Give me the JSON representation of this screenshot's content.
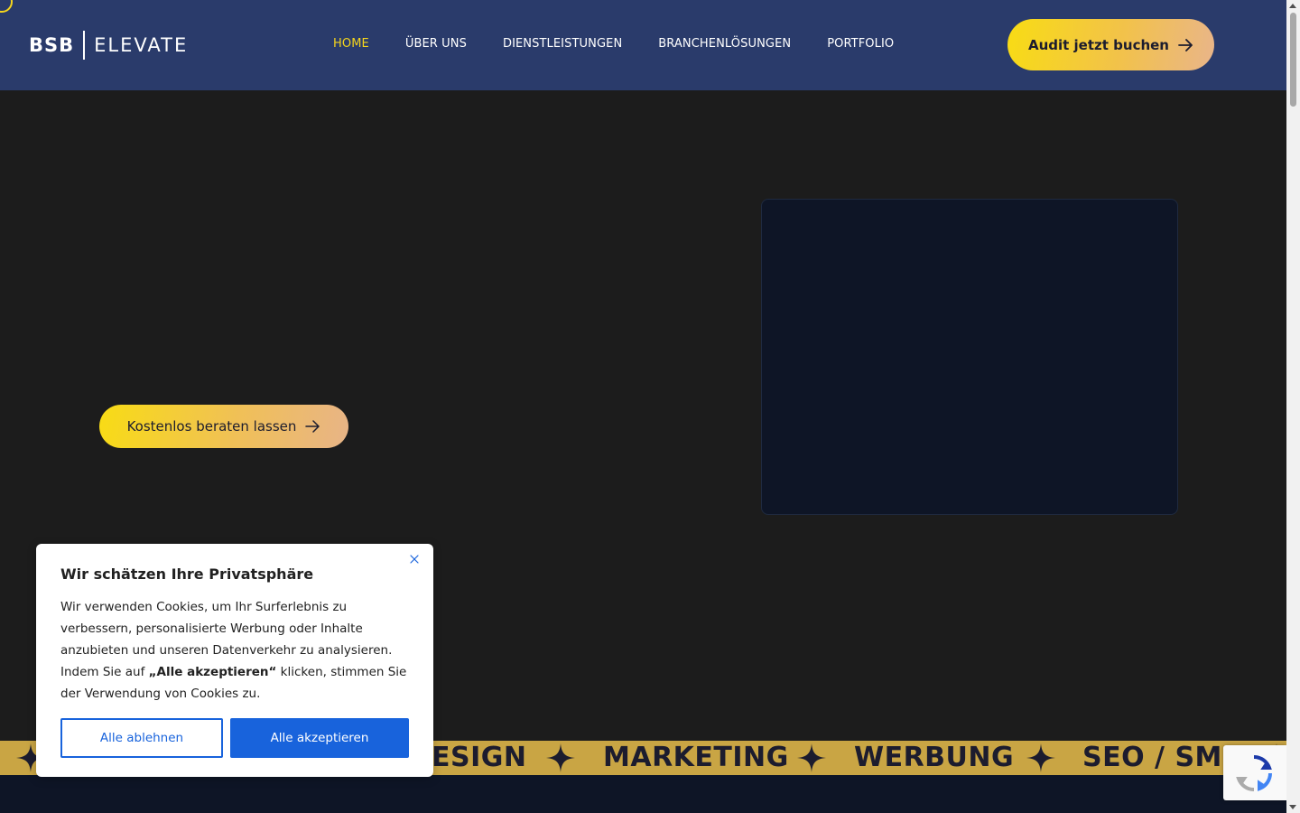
{
  "brand": {
    "part1": "BSB",
    "part2": "ELEVATE"
  },
  "nav": {
    "items": [
      {
        "label": "HOME",
        "active": true
      },
      {
        "label": "ÜBER UNS"
      },
      {
        "label": "DIENSTLEISTUNGEN"
      },
      {
        "label": "BRANCHENLÖSUNGEN"
      },
      {
        "label": "PORTFOLIO"
      }
    ]
  },
  "header": {
    "cta_label": "Audit jetzt buchen"
  },
  "hero": {
    "cta_label": "Kostenlos beraten lassen"
  },
  "ticker": {
    "words": [
      "ESIGN",
      "MARKETING",
      "WERBUNG",
      "SEO / SMM"
    ]
  },
  "cookie": {
    "title": "Wir schätzen Ihre Privatsphäre",
    "text_before": "Wir verwenden Cookies, um Ihr Surferlebnis zu verbessern, personalisierte Werbung oder Inhalte anzubieten und unseren Datenverkehr zu analysieren. Indem Sie auf ",
    "text_bold": "„Alle akzeptieren“",
    "text_after": " klicken, stimmen Sie der Verwendung von Cookies zu.",
    "reject_label": "Alle ablehnen",
    "accept_label": "Alle akzeptieren"
  },
  "colors": {
    "header_bg": "#2a3b6b",
    "accent_yellow": "#f5d51c",
    "page_bg": "#1c1c1c",
    "ticker_bg": "#c9a544",
    "cookie_blue": "#1863dc"
  },
  "icons": {
    "arrow": "arrow-right-icon",
    "close": "close-icon",
    "star": "four-point-star-icon",
    "recaptcha": "recaptcha-icon"
  }
}
